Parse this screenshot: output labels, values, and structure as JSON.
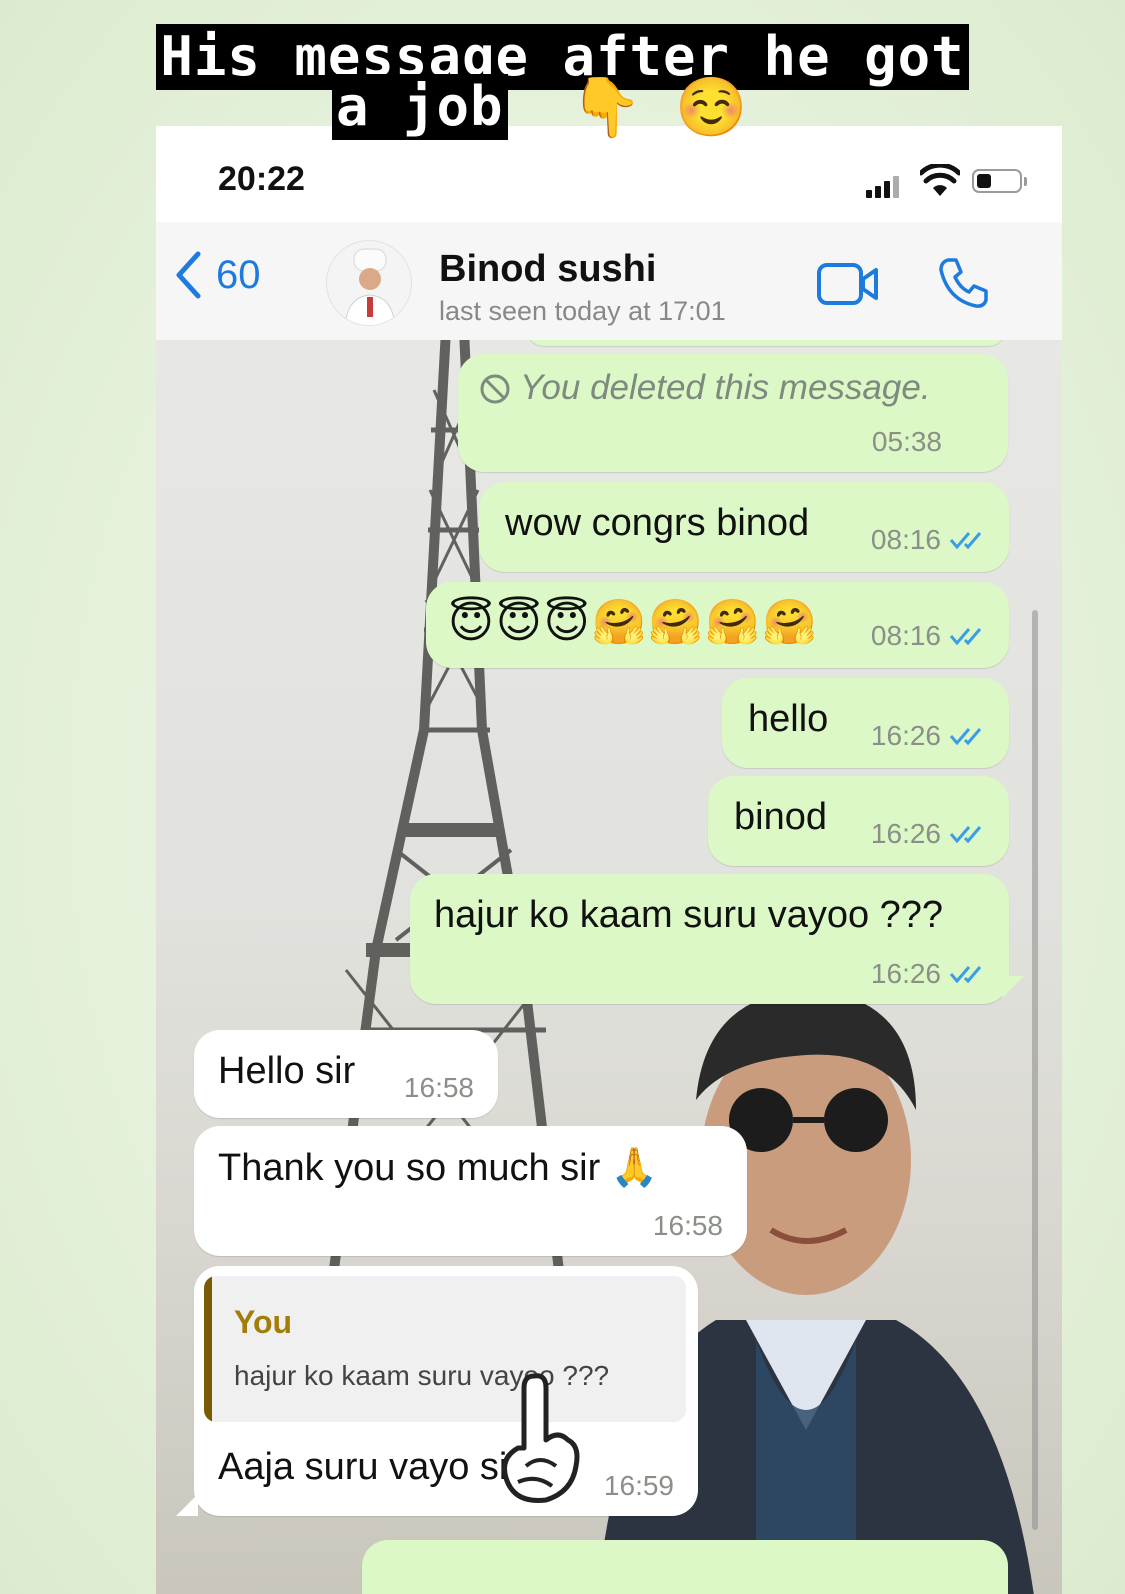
{
  "caption": {
    "line1": "His message after he got",
    "line2": "a job",
    "emoji1": "👇",
    "emoji2": "☺️"
  },
  "status": {
    "time": "20:22"
  },
  "header": {
    "back_count": "60",
    "contact_name": "Binod sushi",
    "last_seen": "last seen today at 17:01"
  },
  "messages": [
    {
      "dir": "out",
      "text": "You deleted this message.",
      "time": "05:38",
      "deleted": true
    },
    {
      "dir": "out",
      "text": "wow congrs binod",
      "time": "08:16",
      "read": true
    },
    {
      "dir": "out",
      "text": "😇😇😇🤗🤗🤗🤗",
      "time": "08:16",
      "read": true
    },
    {
      "dir": "out",
      "text": "hello",
      "time": "16:26",
      "read": true
    },
    {
      "dir": "out",
      "text": "binod",
      "time": "16:26",
      "read": true
    },
    {
      "dir": "out",
      "text": "hajur ko kaam suru vayoo ???",
      "time": "16:26",
      "read": true
    },
    {
      "dir": "in",
      "text": "Hello sir",
      "time": "16:58"
    },
    {
      "dir": "in",
      "text": "Thank you so much sir 🙏",
      "time": "16:58"
    },
    {
      "dir": "in",
      "text": "Aaja suru vayo sir",
      "time": "16:59",
      "reply_to": {
        "author": "You",
        "text": "hajur ko kaam suru vayoo ???"
      }
    }
  ],
  "colors": {
    "outgoing_bubble": "#dcf8c6",
    "incoming_bubble": "#ffffff",
    "ios_blue": "#1d7be0",
    "read_tick": "#3a9de8",
    "quote_author": "#a27d07"
  },
  "icons": {
    "back": "chevron-left-icon",
    "video": "video-camera-icon",
    "call": "phone-icon",
    "deleted": "prohibited-icon",
    "pointer": "pointing-hand-icon"
  }
}
